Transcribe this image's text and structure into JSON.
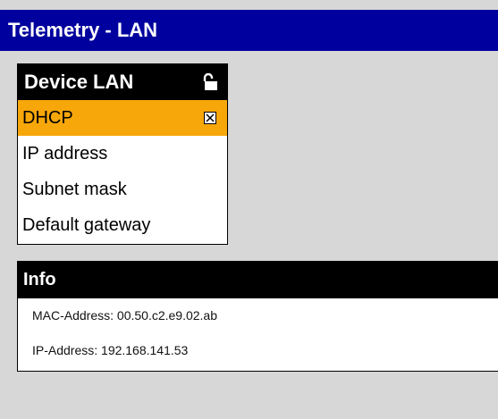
{
  "window": {
    "title": "Telemetry - LAN"
  },
  "menu": {
    "title": "Device LAN",
    "header_icon": "unlocked-padlock-icon",
    "items": [
      {
        "label": "DHCP",
        "selected": true,
        "checkbox": "checked"
      },
      {
        "label": "IP address"
      },
      {
        "label": "Subnet mask"
      },
      {
        "label": "Default gateway"
      }
    ]
  },
  "info": {
    "title": "Info",
    "lines": [
      "MAC-Address: 00.50.c2.e9.02.ab",
      "IP-Address: 192.168.141.53"
    ]
  },
  "colors": {
    "title_bar": "#00009e",
    "background": "#d7d7d7",
    "selection": "#f7a70a",
    "header": "#000000"
  }
}
